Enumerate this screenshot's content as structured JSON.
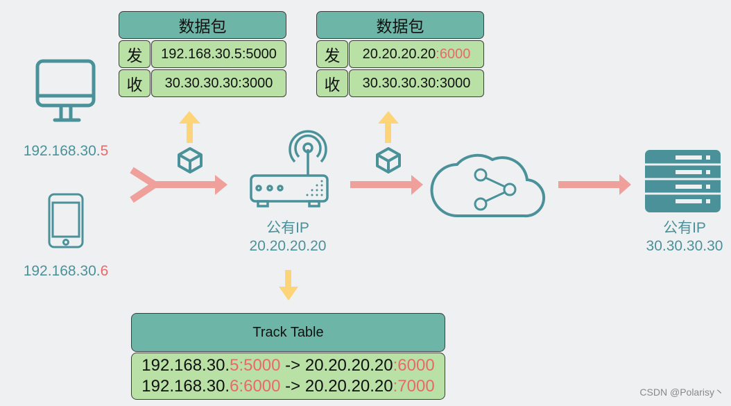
{
  "colors": {
    "icon_teal": "#4a9199",
    "header_teal": "#6db5a6",
    "cell_green": "#b9e0a5",
    "highlight_red": "#e9686a",
    "flow_arrow": "#f0a09b",
    "upload_arrow": "#fdd477"
  },
  "packet_left": {
    "title": "数据包",
    "send_key": "发",
    "send_value": "192.168.30.5:5000",
    "recv_key": "收",
    "recv_value": "30.30.30.30:3000"
  },
  "packet_right": {
    "title": "数据包",
    "send_key": "发",
    "send_value_plain": "20.20.20.20",
    "send_value_red": ":6000",
    "recv_key": "收",
    "recv_value": "30.30.30.30:3000"
  },
  "devices": {
    "desktop": {
      "icon": "desktop-icon",
      "ip_prefix": "192.168.30.",
      "ip_suffix": "5"
    },
    "phone": {
      "icon": "phone-icon",
      "ip_prefix": "192.168.30.",
      "ip_suffix": "6"
    },
    "router": {
      "icon": "router-icon",
      "label": "公有IP",
      "ip": "20.20.20.20"
    },
    "cloud": {
      "icon": "cloud-share-icon"
    },
    "server": {
      "icon": "server-icon",
      "label": "公有IP",
      "ip": "30.30.30.30"
    }
  },
  "track_table": {
    "title": "Track Table",
    "rows": [
      {
        "src_prefix": "192.168.30.",
        "src_red": "5:5000",
        "arrow": " -> ",
        "dst_prefix": "20.20.20.20",
        "dst_red": ":6000"
      },
      {
        "src_prefix": "192.168.30.",
        "src_red": "6:6000",
        "arrow": " -> ",
        "dst_prefix": "20.20.20.20",
        "dst_red": ":7000"
      }
    ]
  },
  "watermark": "CSDN @Polarisy丶"
}
